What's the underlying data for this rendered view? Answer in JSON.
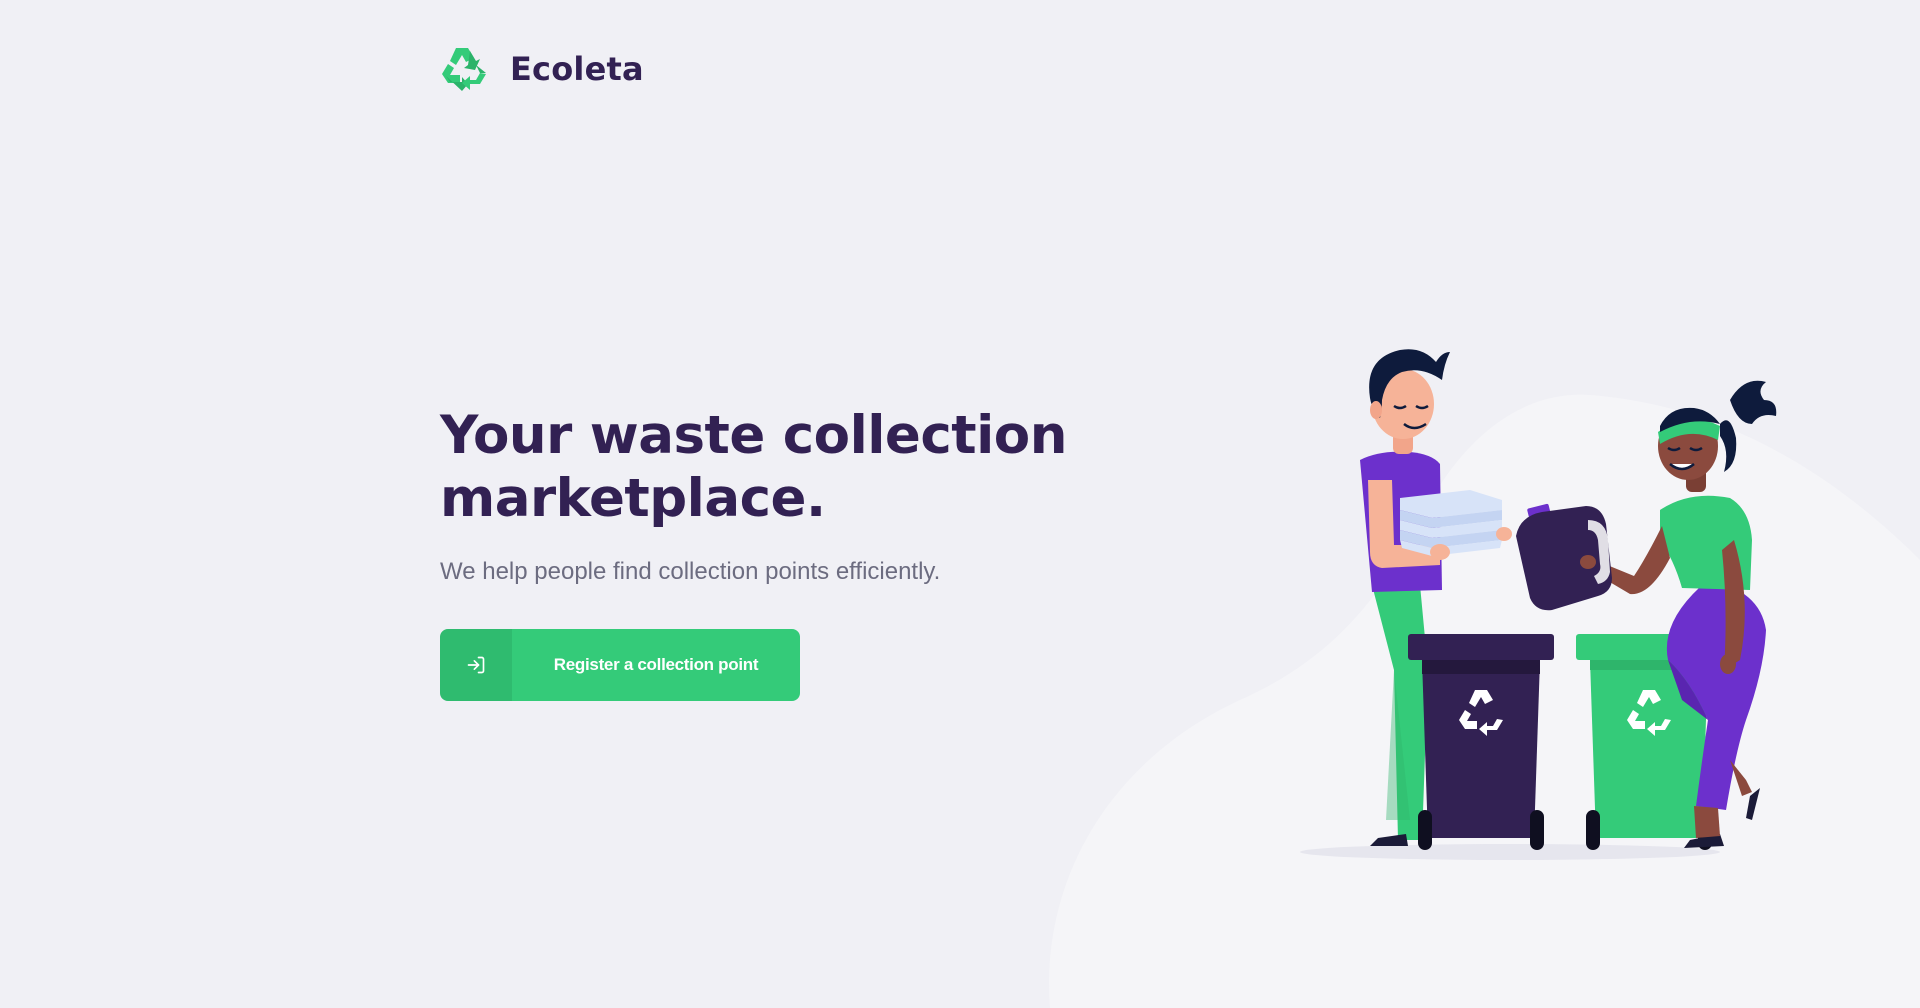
{
  "header": {
    "logo_icon": "recycle-icon",
    "brand_name": "Ecoleta"
  },
  "hero": {
    "title_line1": "Your waste collection",
    "title_line2": "marketplace.",
    "subtitle": "We help people find collection points efficiently."
  },
  "cta": {
    "icon": "log-in-icon",
    "label": "Register a collection point"
  },
  "illustration": {
    "icon": "recycling-people-illustration"
  },
  "colors": {
    "background": "#F0F0F5",
    "primary": "#34CB79",
    "title": "#322153",
    "text": "#6C6C80",
    "purple": "#6C30CC"
  }
}
